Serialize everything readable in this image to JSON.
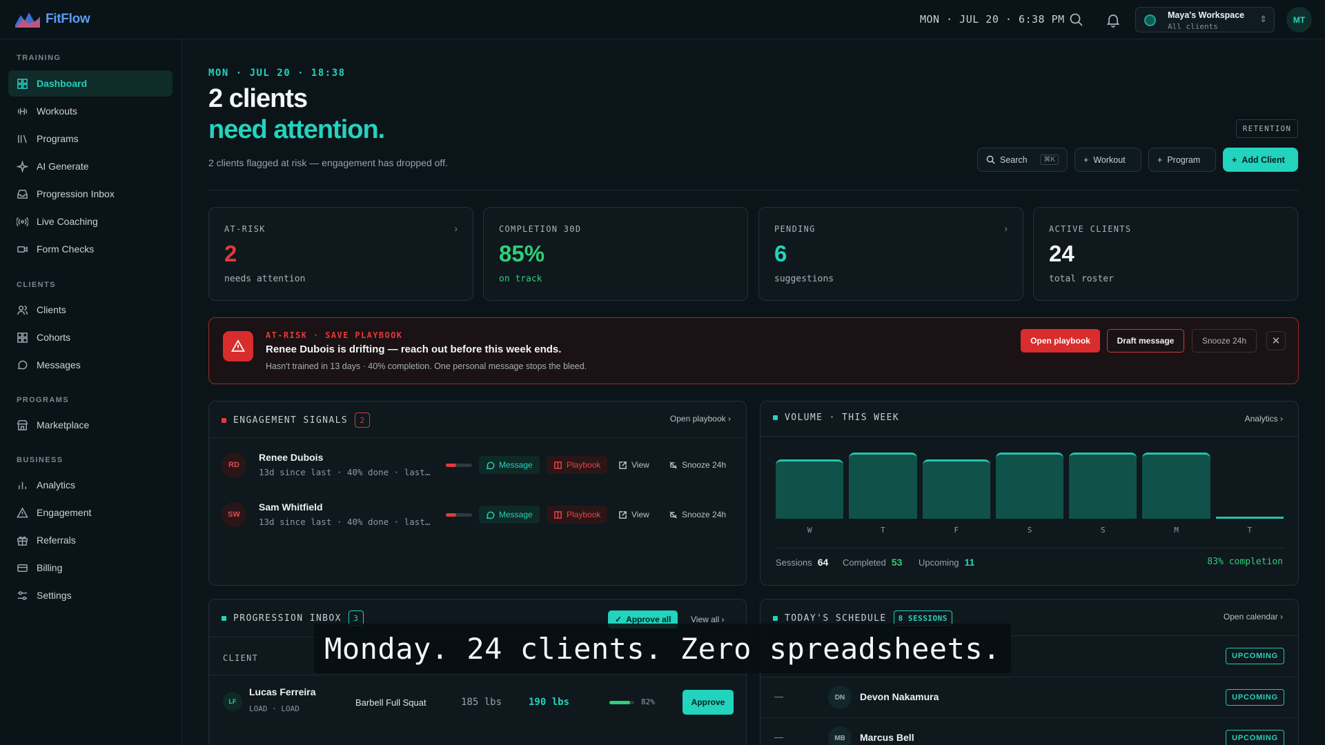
{
  "app": {
    "name": "FitFlow"
  },
  "topbar": {
    "datetime": "MON · JUL 20 · 6:38 PM",
    "workspace_name": "Maya's Workspace",
    "workspace_sub": "All clients",
    "avatar_initials": "MT"
  },
  "sidebar": {
    "training_label": "TRAINING",
    "clients_label": "CLIENTS",
    "programs_label": "PROGRAMS",
    "business_label": "BUSINESS",
    "training": [
      "Dashboard",
      "Workouts",
      "Programs",
      "AI Generate",
      "Progression Inbox",
      "Live Coaching",
      "Form Checks"
    ],
    "clients": [
      "Clients",
      "Cohorts",
      "Messages"
    ],
    "programs": [
      "Marketplace"
    ],
    "business": [
      "Analytics",
      "Engagement",
      "Referrals",
      "Billing",
      "Settings"
    ]
  },
  "header": {
    "date_line": "MON · JUL 20 · 18:38",
    "title_line1": "2 clients",
    "title_line2": "need attention.",
    "subtitle": "2 clients flagged at risk — engagement has dropped off.",
    "retention_label": "RETENTION",
    "search_label": "Search",
    "search_kbd": "⌘K",
    "workout_label": "Workout",
    "program_label": "Program",
    "add_client_label": "Add Client"
  },
  "stats": [
    {
      "label": "AT-RISK",
      "value": "2",
      "note": "needs attention",
      "color": "#e23b3b"
    },
    {
      "label": "COMPLETION 30D",
      "value": "85%",
      "note": "on track",
      "color": "#2fcf7a"
    },
    {
      "label": "PENDING",
      "value": "6",
      "note": "suggestions",
      "color": "#24d3bd"
    },
    {
      "label": "ACTIVE CLIENTS",
      "value": "24",
      "note": "total roster",
      "color": "#f3f6f7"
    }
  ],
  "alert": {
    "tag": "AT-RISK · SAVE PLAYBOOK",
    "title": "Renee Dubois is drifting — reach out before this week ends.",
    "desc": "Hasn't trained in 13 days · 40% completion. One personal message stops the bleed.",
    "open_label": "Open playbook",
    "draft_label": "Draft message",
    "snooze_label": "Snooze 24h"
  },
  "engagement": {
    "title": "ENGAGEMENT SIGNALS",
    "count": "2",
    "link": "Open playbook",
    "rows": [
      {
        "initials": "RD",
        "name": "Renee Dubois",
        "sub": "13d since last · 40% done · last…",
        "completion": 0.4
      },
      {
        "initials": "SW",
        "name": "Sam Whitfield",
        "sub": "13d since last · 40% done · last…",
        "completion": 0.4
      }
    ],
    "message_label": "Message",
    "playbook_label": "Playbook",
    "view_label": "View",
    "snooze_label": "Snooze 24h"
  },
  "volume": {
    "title": "VOLUME · THIS WEEK",
    "link": "Analytics",
    "sessions_label": "Sessions",
    "sessions": "64",
    "completed_label": "Completed",
    "completed": "53",
    "upcoming_label": "Upcoming",
    "upcoming": "11",
    "completion_text": "83% completion"
  },
  "chart_data": {
    "type": "bar",
    "title": "VOLUME · THIS WEEK",
    "categories": [
      "W",
      "T",
      "F",
      "S",
      "S",
      "M",
      "T"
    ],
    "values": [
      9,
      10,
      9,
      10,
      10,
      10,
      0
    ],
    "ylim": [
      0,
      10
    ]
  },
  "progression": {
    "title": "PROGRESSION INBOX",
    "count": "3",
    "approve_all": "Approve all",
    "view_all": "View all",
    "col_client": "CLIENT",
    "rows": [
      {
        "initials": "LF",
        "name": "Lucas Ferreira",
        "sub": "LOAD · LOAD",
        "exercise": "Barbell Full Squat",
        "from": "185 lbs",
        "to": "190 lbs",
        "confidence": "82%",
        "approve": "Approve"
      }
    ]
  },
  "schedule": {
    "title": "TODAY'S SCHEDULE",
    "count": "8 SESSIONS",
    "link": "Open calendar",
    "rows": [
      {
        "time": "",
        "initials": "",
        "name": "",
        "status": "UPCOMING"
      },
      {
        "time": "—",
        "initials": "DN",
        "name": "Devon Nakamura",
        "status": "UPCOMING"
      },
      {
        "time": "—",
        "initials": "MB",
        "name": "Marcus Bell",
        "status": "UPCOMING"
      }
    ]
  },
  "caption": "Monday. 24 clients. Zero spreadsheets."
}
